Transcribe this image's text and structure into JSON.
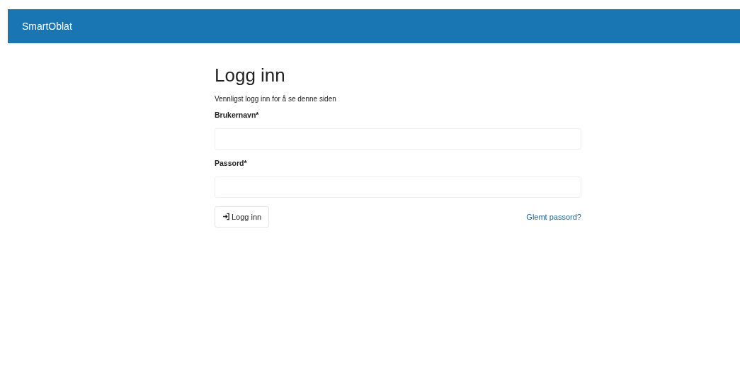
{
  "navbar": {
    "brand": "SmartOblat"
  },
  "form": {
    "title": "Logg inn",
    "subtitle": "Vennligst logg inn for å se denne siden",
    "fields": [
      {
        "label": "Brukernavn*"
      },
      {
        "label": "Passord*"
      }
    ],
    "submit": {
      "label": "Logg inn"
    },
    "forgot_link": "Glemt passord?"
  }
}
